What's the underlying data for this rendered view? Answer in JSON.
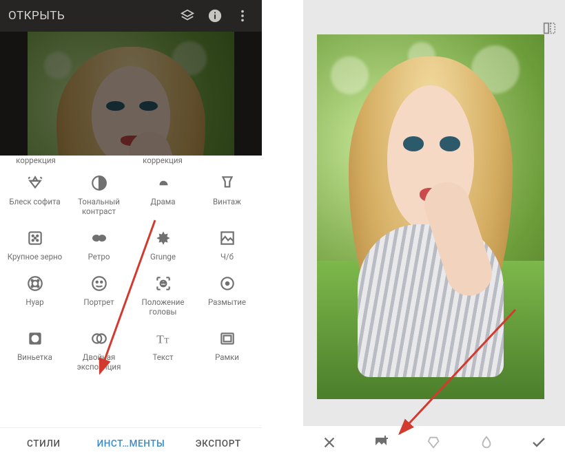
{
  "topbar": {
    "open_label": "ОТКРЫТЬ"
  },
  "partial_labels": {
    "c0": "коррекция",
    "c1": "",
    "c2": "коррекция",
    "c3": ""
  },
  "tools": {
    "r0c0": "Блеск софита",
    "r0c1": "Тональный контраст",
    "r0c2": "Драма",
    "r0c3": "Винтаж",
    "r1c0": "Крупное зерно",
    "r1c1": "Ретро",
    "r1c2": "Grunge",
    "r1c3": "Ч/б",
    "r2c0": "Нуар",
    "r2c1": "Портрет",
    "r2c2": "Положение головы",
    "r2c3": "Размытие",
    "r3c0": "Виньетка",
    "r3c1": "Двойная экспозиция",
    "r3c2": "Текст",
    "r3c3": "Рамки"
  },
  "tabs": {
    "styles": "СТИЛИ",
    "tools": "ИНСТ…МЕНТЫ",
    "export": "ЭКСПОРТ"
  },
  "colors": {
    "accent": "#3a89c9",
    "arrow": "#d23a2f"
  }
}
